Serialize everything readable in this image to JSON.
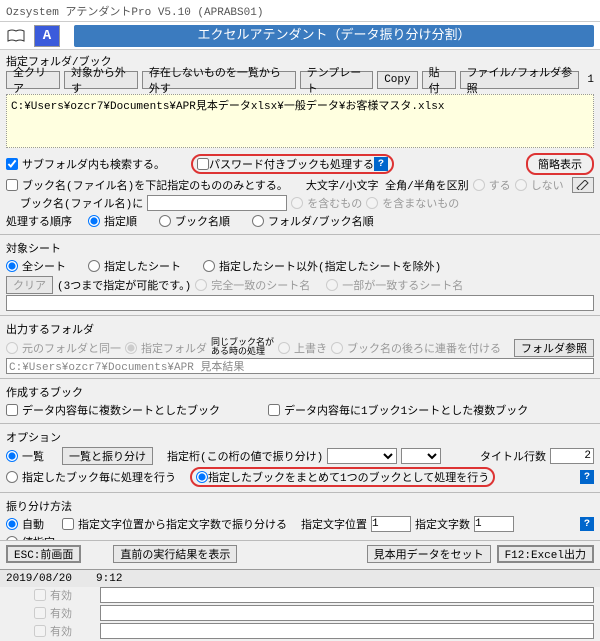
{
  "window_title": "Ozsystem アテンダントPro V5.10 (APRABS01)",
  "logo_letter": "A",
  "banner": "エクセルアテンダント（データ振り分け分割）",
  "sec1": {
    "title": "指定フォルダ/ブック",
    "btn_clear": "全クリア",
    "btn_exclude": "対象から外す",
    "btn_exclude_missing": "存在しないものを一覧から外す",
    "btn_template": "テンプレート",
    "btn_copy": "Copy",
    "btn_paste": "貼付",
    "btn_browse": "ファイル/フォルダ参照",
    "count": "1",
    "path": "C:¥Users¥ozcr7¥Documents¥APR見本データxlsx¥一般データ¥お客様マスタ.xlsx"
  },
  "sec2": {
    "chk_subfolder": "サブフォルダ内も検索する。",
    "chk_password": "パスワード付きブックも処理する",
    "btn_simple": "簡略表示",
    "chk_bookname": "ブック名(ファイル名)を下記指定のもののみとする。",
    "lbl_case": "大文字/小文字 全角/半角を区別",
    "opt_yes": "する",
    "opt_no": "しない",
    "lbl_bookname2": "ブック名(ファイル名)に",
    "opt_contain": "を含むもの",
    "opt_notcontain": "を含まないもの",
    "lbl_order": "処理する順序",
    "opt_order1": "指定順",
    "opt_order2": "ブック名順",
    "opt_order3": "フォルダ/ブック名順"
  },
  "sec3": {
    "title": "対象シート",
    "opt_all": "全シート",
    "opt_spec": "指定したシート",
    "opt_except": "指定したシート以外(指定したシートを除外)",
    "btn_clear": "クリア",
    "hint": "(3つまで指定が可能です。)",
    "opt_exact": "完全一致のシート名",
    "opt_partial": "一部が一致するシート名"
  },
  "sec4": {
    "title": "出力するフォルダ",
    "opt_same": "元のフォルダと同一",
    "opt_folder": "指定フォルダ",
    "lbl_dup": "同じブック名が\nある時の処理",
    "opt_overwrite": "上書き",
    "opt_seq": "ブック名の後ろに連番を付ける",
    "btn_browse": "フォルダ参照",
    "path": "C:¥Users¥ozcr7¥Documents¥APR 見本結果"
  },
  "sec5": {
    "title": "作成するブック",
    "chk1": "データ内容毎に複数シートとしたブック",
    "chk2": "データ内容毎に1ブック1シートとした複数ブック"
  },
  "sec6": {
    "title": "オプション",
    "opt_list": "一覧",
    "btn_listsort": "一覧と振り分け",
    "lbl_digit": "指定桁(この桁の値で振り分け)",
    "lbl_titlerows": "タイトル行数",
    "titlerows_val": "2",
    "opt_each": "指定したブック毎に処理を行う",
    "opt_merge": "指定したブックをまとめて1つのブックとして処理を行う"
  },
  "sec7": {
    "title": "振り分け方法",
    "opt_auto": "自動",
    "chk_pos": "指定文字位置から指定文字数で振り分ける",
    "lbl_pos": "指定文字位置",
    "pos_val": "1",
    "lbl_len": "指定文字数",
    "len_val": "1",
    "opt_val": "値指定",
    "chk_en": "有効"
  },
  "footer": {
    "btn_esc": "ESC:前画面",
    "btn_lastrun": "直前の実行結果を表示",
    "btn_sample": "見本用データをセット",
    "btn_f12": "F12:Excel出力"
  },
  "status": {
    "date": "2019/08/20",
    "time": "9:12"
  }
}
